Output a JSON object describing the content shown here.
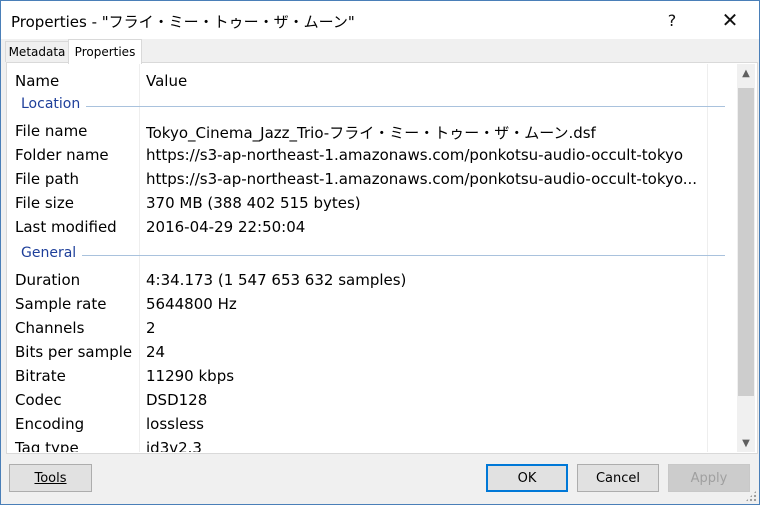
{
  "window": {
    "title": "Properties - \"フライ・ミー・トゥー・ザ・ムーン\"",
    "help_label": "?",
    "close_label": "✕"
  },
  "tabs": [
    {
      "label": "Metadata",
      "active": false
    },
    {
      "label": "Properties",
      "active": true
    }
  ],
  "columns": {
    "name": "Name",
    "value": "Value"
  },
  "groups": {
    "location": {
      "title": "Location",
      "rows": [
        {
          "name": "File name",
          "value": "Tokyo_Cinema_Jazz_Trio-フライ・ミー・トゥー・ザ・ムーン.dsf"
        },
        {
          "name": "Folder name",
          "value": "https://s3-ap-northeast-1.amazonaws.com/ponkotsu-audio-occult-tokyo"
        },
        {
          "name": "File path",
          "value": "https://s3-ap-northeast-1.amazonaws.com/ponkotsu-audio-occult-tokyo..."
        },
        {
          "name": "File size",
          "value": "370 MB (388 402 515 bytes)"
        },
        {
          "name": "Last modified",
          "value": "2016-04-29 22:50:04"
        }
      ]
    },
    "general": {
      "title": "General",
      "rows": [
        {
          "name": "Duration",
          "value": "4:34.173 (1 547 653 632 samples)"
        },
        {
          "name": "Sample rate",
          "value": "5644800 Hz"
        },
        {
          "name": "Channels",
          "value": "2"
        },
        {
          "name": "Bits per sample",
          "value": "24"
        },
        {
          "name": "Bitrate",
          "value": "11290 kbps"
        },
        {
          "name": "Codec",
          "value": "DSD128"
        },
        {
          "name": "Encoding",
          "value": "lossless"
        },
        {
          "name": "Tag type",
          "value": "id3v2.3"
        }
      ]
    }
  },
  "buttons": {
    "tools": "Tools",
    "ok": "OK",
    "cancel": "Cancel",
    "apply": "Apply"
  },
  "colors": {
    "group_text": "#1e3f9a",
    "group_line": "#a9c2dd",
    "ok_border": "#0078d7"
  }
}
